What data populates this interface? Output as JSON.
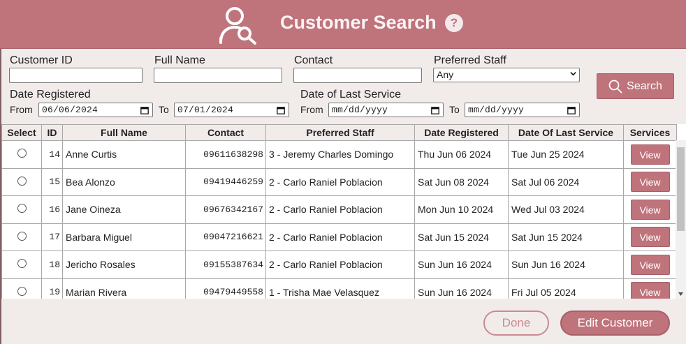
{
  "header": {
    "title": "Customer Search",
    "help_label": "?"
  },
  "filters": {
    "customer_id": {
      "label": "Customer ID",
      "value": ""
    },
    "full_name": {
      "label": "Full Name",
      "value": ""
    },
    "contact": {
      "label": "Contact",
      "value": ""
    },
    "preferred_staff": {
      "label": "Preferred Staff",
      "selected": "Any"
    },
    "date_registered": {
      "label": "Date Registered",
      "from_label": "From",
      "from": "06/06/2024",
      "to_label": "To",
      "to": "07/01/2024"
    },
    "date_last_service": {
      "label": "Date of Last Service",
      "from_label": "From",
      "from": "mm/dd/yyyy",
      "to_label": "To",
      "to": "mm/dd/yyyy"
    },
    "search_label": "Search"
  },
  "table": {
    "columns": [
      "Select",
      "ID",
      "Full Name",
      "Contact",
      "Preferred Staff",
      "Date Registered",
      "Date Of Last Service",
      "Services"
    ],
    "view_label": "View",
    "rows": [
      {
        "id": "14",
        "name": "Anne Curtis",
        "contact": "09611638298",
        "staff": "3 - Jeremy Charles Domingo",
        "registered": "Thu Jun 06 2024",
        "last_service": "Tue Jun 25 2024"
      },
      {
        "id": "15",
        "name": "Bea Alonzo",
        "contact": "09419446259",
        "staff": "2 - Carlo Raniel Poblacion",
        "registered": "Sat Jun 08 2024",
        "last_service": "Sat Jul 06 2024"
      },
      {
        "id": "16",
        "name": "Jane Oineza",
        "contact": "09676342167",
        "staff": "2 - Carlo Raniel Poblacion",
        "registered": "Mon Jun 10 2024",
        "last_service": "Wed Jul 03 2024"
      },
      {
        "id": "17",
        "name": "Barbara Miguel",
        "contact": "09047216621",
        "staff": "2 - Carlo Raniel Poblacion",
        "registered": "Sat Jun 15 2024",
        "last_service": "Sat Jun 15 2024"
      },
      {
        "id": "18",
        "name": "Jericho Rosales",
        "contact": "09155387634",
        "staff": "2 - Carlo Raniel Poblacion",
        "registered": "Sun Jun 16 2024",
        "last_service": "Sun Jun 16 2024"
      },
      {
        "id": "19",
        "name": "Marian Rivera",
        "contact": "09479449558",
        "staff": "1 - Trisha Mae Velasquez",
        "registered": "Sun Jun 16 2024",
        "last_service": "Fri Jul 05 2024"
      }
    ]
  },
  "footer": {
    "done_label": "Done",
    "edit_label": "Edit Customer"
  },
  "colors": {
    "accent": "#bf737b",
    "background": "#f1ecea"
  }
}
